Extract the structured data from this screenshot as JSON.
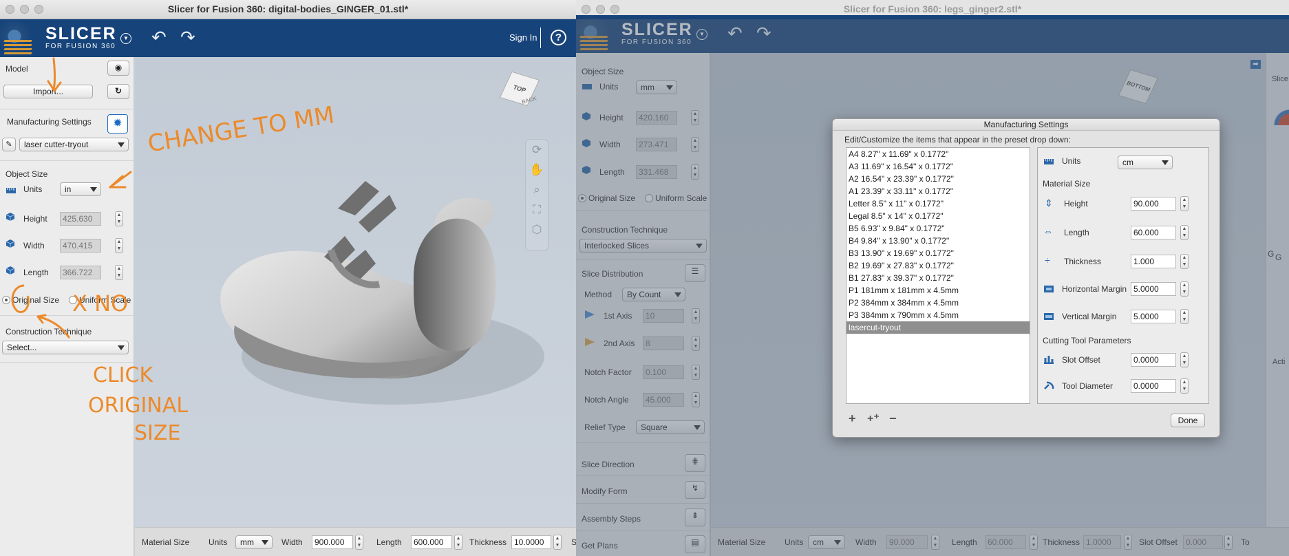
{
  "left": {
    "title": "Slicer for Fusion 360: digital-bodies_GINGER_01.stl*",
    "brand": {
      "name": "SLICER",
      "sub": "FOR FUSION 360"
    },
    "sign_in": "Sign In",
    "help": "?",
    "model": {
      "label": "Model",
      "import_label": "Import..."
    },
    "manufacturing": {
      "label": "Manufacturing Settings",
      "preset": "laser cutter-tryout"
    },
    "object_size": {
      "label": "Object Size",
      "units_label": "Units",
      "units_value": "in",
      "height_label": "Height",
      "height_value": "425.630",
      "width_label": "Width",
      "width_value": "470.415",
      "length_label": "Length",
      "length_value": "366.722",
      "original_size": "Original Size",
      "uniform_scale": "Uniform Scale"
    },
    "construction": {
      "label": "Construction Technique",
      "value": "Select..."
    },
    "view_cube": "TOP",
    "view_cube_back": "BACK",
    "bottom": {
      "material_size": "Material Size",
      "units_label": "Units",
      "units_value": "mm",
      "width_label": "Width",
      "width_value": "900.000",
      "length_label": "Length",
      "length_value": "600.000",
      "thickness_label": "Thickness",
      "thickness_value": "10.0000",
      "trailing": "S"
    },
    "annotations": {
      "change_to_mm": "CHANGE TO MM",
      "x_no": "X  NO",
      "click": "CLICK",
      "original": "ORIGINAL",
      "size": "SIZE"
    }
  },
  "right": {
    "title": "Slicer for Fusion 360: legs_ginger2.stl*",
    "brand": {
      "name": "SLICER",
      "sub": "FOR FUSION 360"
    },
    "object_size": {
      "label": "Object Size",
      "units_label": "Units",
      "units_value": "mm",
      "height_label": "Height",
      "height_value": "420.160",
      "width_label": "Width",
      "width_value": "273.471",
      "length_label": "Length",
      "length_value": "331.468",
      "original_size": "Original Size",
      "uniform_scale": "Uniform Scale"
    },
    "construction": {
      "label": "Construction Technique",
      "value": "Interlocked Slices"
    },
    "distribution": {
      "label": "Slice Distribution",
      "method_label": "Method",
      "method_value": "By Count",
      "axis1_label": "1st Axis",
      "axis1_value": "10",
      "axis2_label": "2nd Axis",
      "axis2_value": "8",
      "notch_factor_label": "Notch Factor",
      "notch_factor_value": "0.100",
      "notch_angle_label": "Notch Angle",
      "notch_angle_value": "45.000",
      "relief_label": "Relief Type",
      "relief_value": "Square"
    },
    "sections": {
      "slice_direction": "Slice Direction",
      "modify_form": "Modify Form",
      "assembly_steps": "Assembly Steps",
      "get_plans": "Get Plans"
    },
    "right_panel": {
      "slice": "Slice",
      "g": "G",
      "acti": "Acti"
    },
    "view_cube": "BOTTOM",
    "bottom": {
      "material_size": "Material Size",
      "units_label": "Units",
      "units_value": "cm",
      "width_label": "Width",
      "width_value": "90.000",
      "length_label": "Length",
      "length_value": "60.000",
      "thickness_label": "Thickness",
      "thickness_value": "1.0000",
      "slot_offset_label": "Slot Offset",
      "slot_offset_value": "0.000",
      "trailing": "To"
    },
    "dialog": {
      "title": "Manufacturing Settings",
      "instructions": "Edit/Customize the items that appear in the preset drop down:",
      "presets": [
        "A4 8.27\" x 11.69\" x 0.1772\"",
        "A3 11.69\" x 16.54\" x 0.1772\"",
        "A2 16.54\" x 23.39\" x 0.1772\"",
        "A1 23.39\" x 33.11\" x 0.1772\"",
        "Letter 8.5\" x 11\" x 0.1772\"",
        "Legal 8.5\" x 14\" x 0.1772\"",
        "B5 6.93\" x 9.84\" x 0.1772\"",
        "B4 9.84\" x 13.90\" x 0.1772\"",
        "B3 13.90\" x 19.69\" x 0.1772\"",
        "B2 19.69\" x 27.83\" x 0.1772\"",
        "B1 27.83\" x 39.37\" x 0.1772\"",
        "P1 181mm x 181mm x 4.5mm",
        "P2 384mm x 384mm x 4.5mm",
        "P3 384mm x 790mm x 4.5mm",
        "lasercut-tryout"
      ],
      "selected_index": 14,
      "units_label": "Units",
      "units_value": "cm",
      "material_size": "Material Size",
      "height_label": "Height",
      "height_value": "90.000",
      "length_label": "Length",
      "length_value": "60.000",
      "thickness_label": "Thickness",
      "thickness_value": "1.000",
      "hmargin_label": "Horizontal Margin",
      "hmargin_value": "5.0000",
      "vmargin_label": "Vertical Margin",
      "vmargin_value": "5.0000",
      "cutting": "Cutting Tool Parameters",
      "slot_offset_label": "Slot  Offset",
      "slot_offset_value": "0.0000",
      "tool_diameter_label": "Tool Diameter",
      "tool_diameter_value": "0.0000",
      "add": "+",
      "add_copy": "+⁺",
      "remove": "−",
      "done": "Done"
    }
  },
  "colors": {
    "appbar": "#16437a",
    "annotation": "#ec8a2b"
  }
}
